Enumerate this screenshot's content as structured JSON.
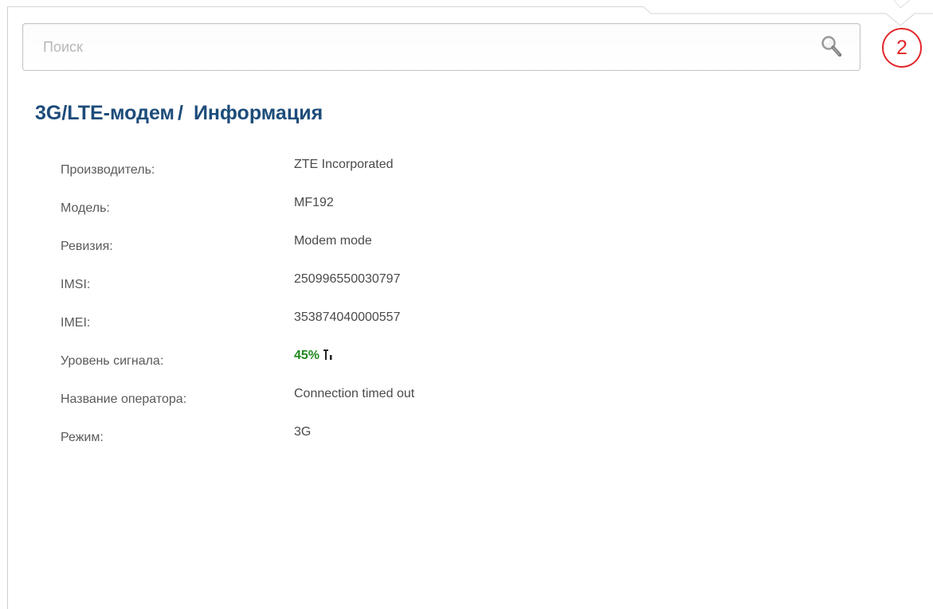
{
  "search": {
    "placeholder": "Поиск"
  },
  "notifications": {
    "count": "2",
    "color": "#e3262a"
  },
  "page": {
    "section": "3G/LTE-модем",
    "separator": "/",
    "subsection": "Информация",
    "title_color": "#1d4c7a"
  },
  "info": [
    {
      "label": "Производитель:",
      "value": "ZTE Incorporated"
    },
    {
      "label": "Модель:",
      "value": "MF192"
    },
    {
      "label": "Ревизия:",
      "value": "Modem mode"
    },
    {
      "label": "IMSI:",
      "value": "250996550030797"
    },
    {
      "label": "IMEI:",
      "value": "353874040000557"
    },
    {
      "label": "Уровень сигнала:",
      "value": "45%",
      "icon": "signal-antenna-icon",
      "value_color": "#1f8a1f"
    },
    {
      "label": "Название оператора:",
      "value": "Connection timed out"
    },
    {
      "label": "Режим:",
      "value": "3G"
    }
  ]
}
